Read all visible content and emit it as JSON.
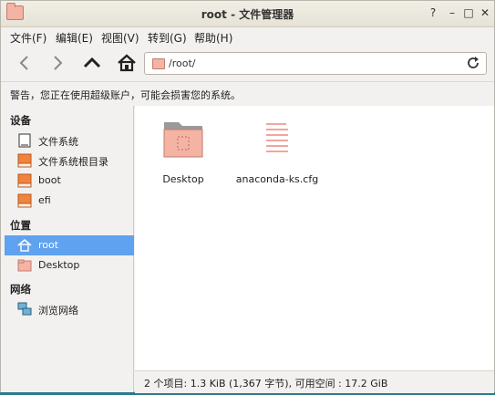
{
  "window": {
    "title": "root - 文件管理器"
  },
  "menu": [
    "文件(F)",
    "编辑(E)",
    "视图(V)",
    "转到(G)",
    "帮助(H)"
  ],
  "path": {
    "value": "/root/"
  },
  "warning": "警告，您正在使用超级账户，可能会损害您的系统。",
  "sidebar": {
    "devices_heading": "设备",
    "devices": [
      {
        "label": "文件系统",
        "icon": "drive-icon"
      },
      {
        "label": "文件系统根目录",
        "icon": "drive-icon"
      },
      {
        "label": "boot",
        "icon": "drive-icon"
      },
      {
        "label": "efi",
        "icon": "drive-icon"
      }
    ],
    "places_heading": "位置",
    "places": [
      {
        "label": "root",
        "icon": "home-icon",
        "selected": true
      },
      {
        "label": "Desktop",
        "icon": "folder-icon"
      }
    ],
    "network_heading": "网络",
    "network": [
      {
        "label": "浏览网络",
        "icon": "network-icon"
      }
    ]
  },
  "files": [
    {
      "name": "Desktop",
      "icon": "folder-icon"
    },
    {
      "name": "anaconda-ks.cfg",
      "icon": "text-file-icon"
    }
  ],
  "status": "2 个项目: 1.3 KiB (1,367 字节), 可用空间 : 17.2 GiB",
  "colors": {
    "selection": "#5fa2ef",
    "folder": "#f4b3a3",
    "file_lines": "#e88b7a"
  }
}
